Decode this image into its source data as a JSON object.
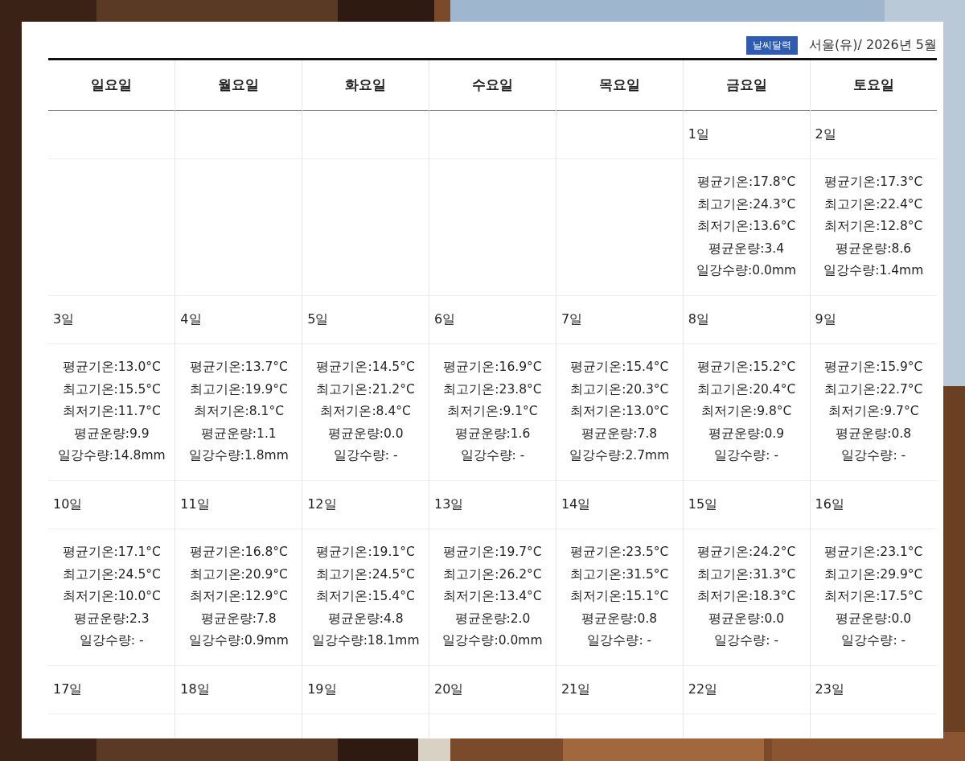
{
  "header": {
    "badge": "날씨달력",
    "location": "서울(유)/ 2026년 5월"
  },
  "weekdays": [
    "일요일",
    "월요일",
    "화요일",
    "수요일",
    "목요일",
    "금요일",
    "토요일"
  ],
  "weeks": [
    {
      "month_start": true,
      "days": [
        {
          "date": "1일",
          "lines": [
            "평균기온:17.8°C",
            "최고기온:24.3°C",
            "최저기온:13.6°C",
            "평균운량:3.4",
            "일강수량:0.0mm"
          ]
        },
        {
          "date": "2일",
          "lines": [
            "평균기온:17.3°C",
            "최고기온:22.4°C",
            "최저기온:12.8°C",
            "평균운량:8.6",
            "일강수량:1.4mm"
          ]
        }
      ]
    },
    {
      "days": [
        {
          "date": "3일",
          "lines": [
            "평균기온:13.0°C",
            "최고기온:15.5°C",
            "최저기온:11.7°C",
            "평균운량:9.9",
            "일강수량:14.8mm"
          ]
        },
        {
          "date": "4일",
          "lines": [
            "평균기온:13.7°C",
            "최고기온:19.9°C",
            "최저기온:8.1°C",
            "평균운량:1.1",
            "일강수량:1.8mm"
          ]
        },
        {
          "date": "5일",
          "lines": [
            "평균기온:14.5°C",
            "최고기온:21.2°C",
            "최저기온:8.4°C",
            "평균운량:0.0",
            "일강수량: -"
          ]
        },
        {
          "date": "6일",
          "lines": [
            "평균기온:16.9°C",
            "최고기온:23.8°C",
            "최저기온:9.1°C",
            "평균운량:1.6",
            "일강수량: -"
          ]
        },
        {
          "date": "7일",
          "lines": [
            "평균기온:15.4°C",
            "최고기온:20.3°C",
            "최저기온:13.0°C",
            "평균운량:7.8",
            "일강수량:2.7mm"
          ]
        },
        {
          "date": "8일",
          "lines": [
            "평균기온:15.2°C",
            "최고기온:20.4°C",
            "최저기온:9.8°C",
            "평균운량:0.9",
            "일강수량: -"
          ]
        },
        {
          "date": "9일",
          "lines": [
            "평균기온:15.9°C",
            "최고기온:22.7°C",
            "최저기온:9.7°C",
            "평균운량:0.8",
            "일강수량: -"
          ]
        }
      ]
    },
    {
      "days": [
        {
          "date": "10일",
          "lines": [
            "평균기온:17.1°C",
            "최고기온:24.5°C",
            "최저기온:10.0°C",
            "평균운량:2.3",
            "일강수량: -"
          ]
        },
        {
          "date": "11일",
          "lines": [
            "평균기온:16.8°C",
            "최고기온:20.9°C",
            "최저기온:12.9°C",
            "평균운량:7.8",
            "일강수량:0.9mm"
          ]
        },
        {
          "date": "12일",
          "lines": [
            "평균기온:19.1°C",
            "최고기온:24.5°C",
            "최저기온:15.4°C",
            "평균운량:4.8",
            "일강수량:18.1mm"
          ]
        },
        {
          "date": "13일",
          "lines": [
            "평균기온:19.7°C",
            "최고기온:26.2°C",
            "최저기온:13.4°C",
            "평균운량:2.0",
            "일강수량:0.0mm"
          ]
        },
        {
          "date": "14일",
          "lines": [
            "평균기온:23.5°C",
            "최고기온:31.5°C",
            "최저기온:15.1°C",
            "평균운량:0.8",
            "일강수량: -"
          ]
        },
        {
          "date": "15일",
          "lines": [
            "평균기온:24.2°C",
            "최고기온:31.3°C",
            "최저기온:18.3°C",
            "평균운량:0.0",
            "일강수량: -"
          ]
        },
        {
          "date": "16일",
          "lines": [
            "평균기온:23.1°C",
            "최고기온:29.9°C",
            "최저기온:17.5°C",
            "평균운량:0.0",
            "일강수량: -"
          ]
        }
      ]
    },
    {
      "days": [
        {
          "date": "17일"
        },
        {
          "date": "18일"
        },
        {
          "date": "19일"
        },
        {
          "date": "20일"
        },
        {
          "date": "21일"
        },
        {
          "date": "22일"
        },
        {
          "date": "23일"
        }
      ]
    }
  ]
}
